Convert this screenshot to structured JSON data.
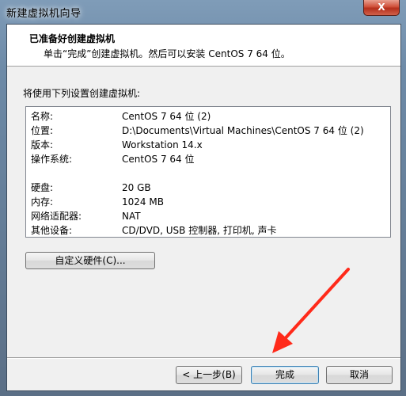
{
  "window": {
    "title": "新建虚拟机向导",
    "close_label": "X"
  },
  "header": {
    "title": "已准备好创建虚拟机",
    "subtitle": "单击“完成”创建虚拟机。然后可以安装 CentOS 7 64 位。"
  },
  "summary": {
    "label": "将使用下列设置创建虚拟机:",
    "rows": [
      {
        "key": "名称:",
        "value": "CentOS 7 64 位 (2)"
      },
      {
        "key": "位置:",
        "value": "D:\\Documents\\Virtual Machines\\CentOS 7 64 位 (2)"
      },
      {
        "key": "版本:",
        "value": "Workstation 14.x"
      },
      {
        "key": "操作系统:",
        "value": "CentOS 7 64 位"
      },
      {
        "key": "硬盘:",
        "value": "20 GB"
      },
      {
        "key": "内存:",
        "value": "1024 MB"
      },
      {
        "key": "网络适配器:",
        "value": "NAT"
      },
      {
        "key": "其他设备:",
        "value": "CD/DVD, USB 控制器, 打印机, 声卡"
      }
    ]
  },
  "buttons": {
    "customize": "自定义硬件(C)...",
    "back": "< 上一步(B)",
    "finish": "完成",
    "cancel": "取消"
  },
  "annotation": {
    "arrow_color": "#ff2a1a"
  }
}
